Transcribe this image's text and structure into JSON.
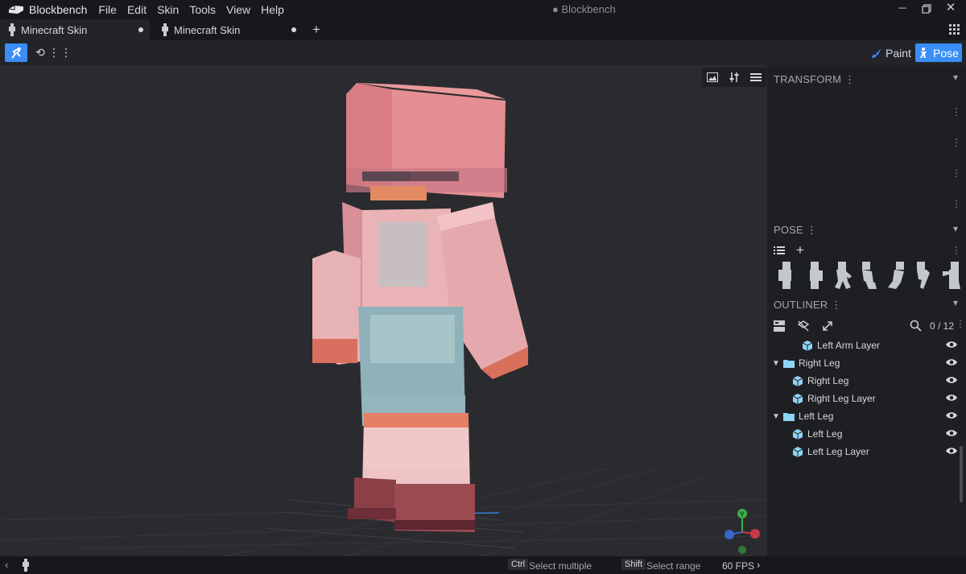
{
  "app": {
    "name": "Blockbench",
    "window_title": "● Blockbench",
    "menu": [
      "File",
      "Edit",
      "Skin",
      "Tools",
      "View",
      "Help"
    ]
  },
  "tabs": [
    {
      "label": "Minecraft Skin",
      "active": true
    },
    {
      "label": "Minecraft Skin",
      "active": false
    }
  ],
  "toolbar": {
    "tools": [
      "pose-tool-icon",
      "sync-icon",
      "more-icon"
    ],
    "modes": [
      {
        "label": "Paint",
        "icon": "brush-icon",
        "active": false
      },
      {
        "label": "Pose",
        "icon": "pose-figure-icon",
        "active": true
      }
    ]
  },
  "viewport": {
    "controls": [
      "image-icon",
      "sliders-icon",
      "menu-icon"
    ],
    "axis_labels": [
      "Y"
    ]
  },
  "panels": {
    "transform": {
      "title": "TRANSFORM"
    },
    "pose": {
      "title": "POSE",
      "preset_count": 7,
      "selected_preset": 2
    },
    "outliner": {
      "title": "OUTLINER",
      "count": "0 / 12",
      "items": [
        {
          "label": "Left Arm Layer",
          "type": "cube",
          "depth": 2
        },
        {
          "label": "Right Leg",
          "type": "group",
          "depth": 0
        },
        {
          "label": "Right Leg",
          "type": "cube",
          "depth": 1
        },
        {
          "label": "Right Leg Layer",
          "type": "cube",
          "depth": 1
        },
        {
          "label": "Left Leg",
          "type": "group",
          "depth": 0
        },
        {
          "label": "Left Leg",
          "type": "cube",
          "depth": 1
        },
        {
          "label": "Left Leg Layer",
          "type": "cube",
          "depth": 1
        }
      ]
    }
  },
  "status": {
    "ctrl_key": "Ctrl",
    "ctrl_hint": "Select multiple",
    "shift_key": "Shift",
    "shift_hint": "Select range",
    "fps": "60 FPS"
  },
  "colors": {
    "accent": "#3a8ef5",
    "panel_bg": "#1e1f23",
    "viewport_bg": "#2a2b2f",
    "cube_icon": "#8fd3f4",
    "folder_icon": "#8fd3f4"
  }
}
